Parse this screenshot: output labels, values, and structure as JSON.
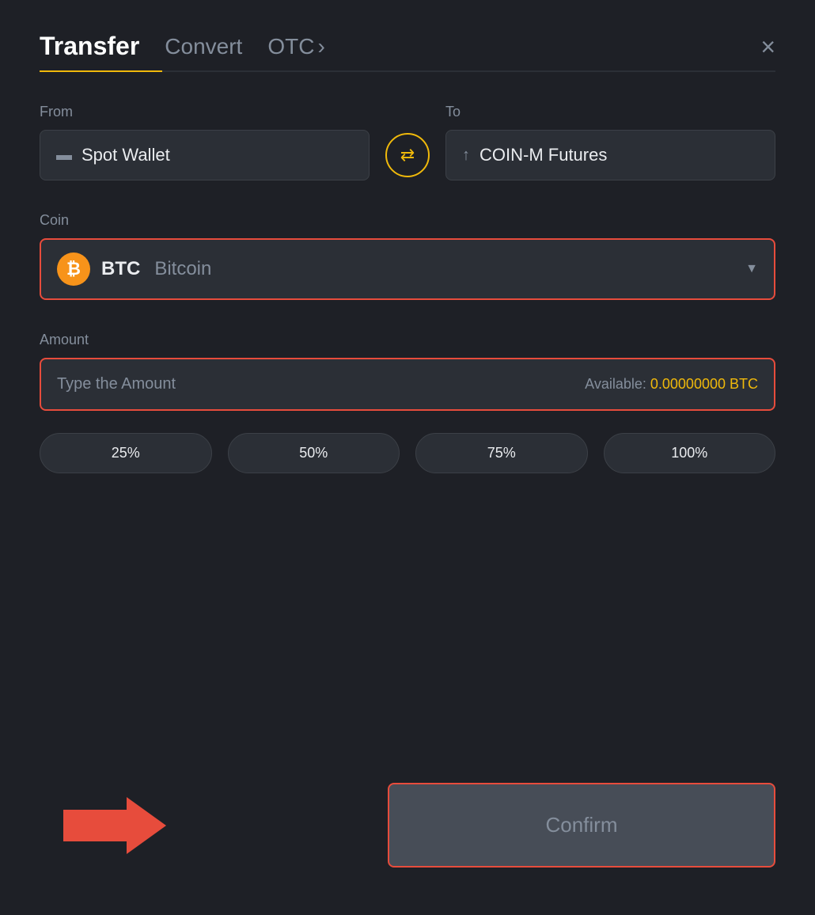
{
  "header": {
    "title": "Transfer",
    "tab_convert": "Convert",
    "tab_otc": "OTC",
    "tab_otc_arrow": "›",
    "close_label": "×"
  },
  "from_section": {
    "label": "From",
    "wallet_icon": "▬",
    "wallet_name": "Spot Wallet"
  },
  "swap": {
    "icon": "⇄"
  },
  "to_section": {
    "label": "To",
    "wallet_icon": "↑",
    "wallet_name": "COIN-M Futures"
  },
  "coin_section": {
    "label": "Coin",
    "coin_symbol": "BTC",
    "coin_name": "Bitcoin",
    "btc_symbol": "₿"
  },
  "amount_section": {
    "label": "Amount",
    "placeholder": "Type the Amount",
    "available_label": "Available:",
    "available_amount": "0.00000000 BTC"
  },
  "pct_buttons": [
    {
      "label": "25%"
    },
    {
      "label": "50%"
    },
    {
      "label": "75%"
    },
    {
      "label": "100%"
    }
  ],
  "confirm_button": {
    "label": "Confirm"
  },
  "colors": {
    "accent": "#f0b90b",
    "danger": "#e74c3c",
    "bg": "#1e2026",
    "surface": "#2b2f36",
    "text_primary": "#eaecef",
    "text_secondary": "#848e9c"
  }
}
